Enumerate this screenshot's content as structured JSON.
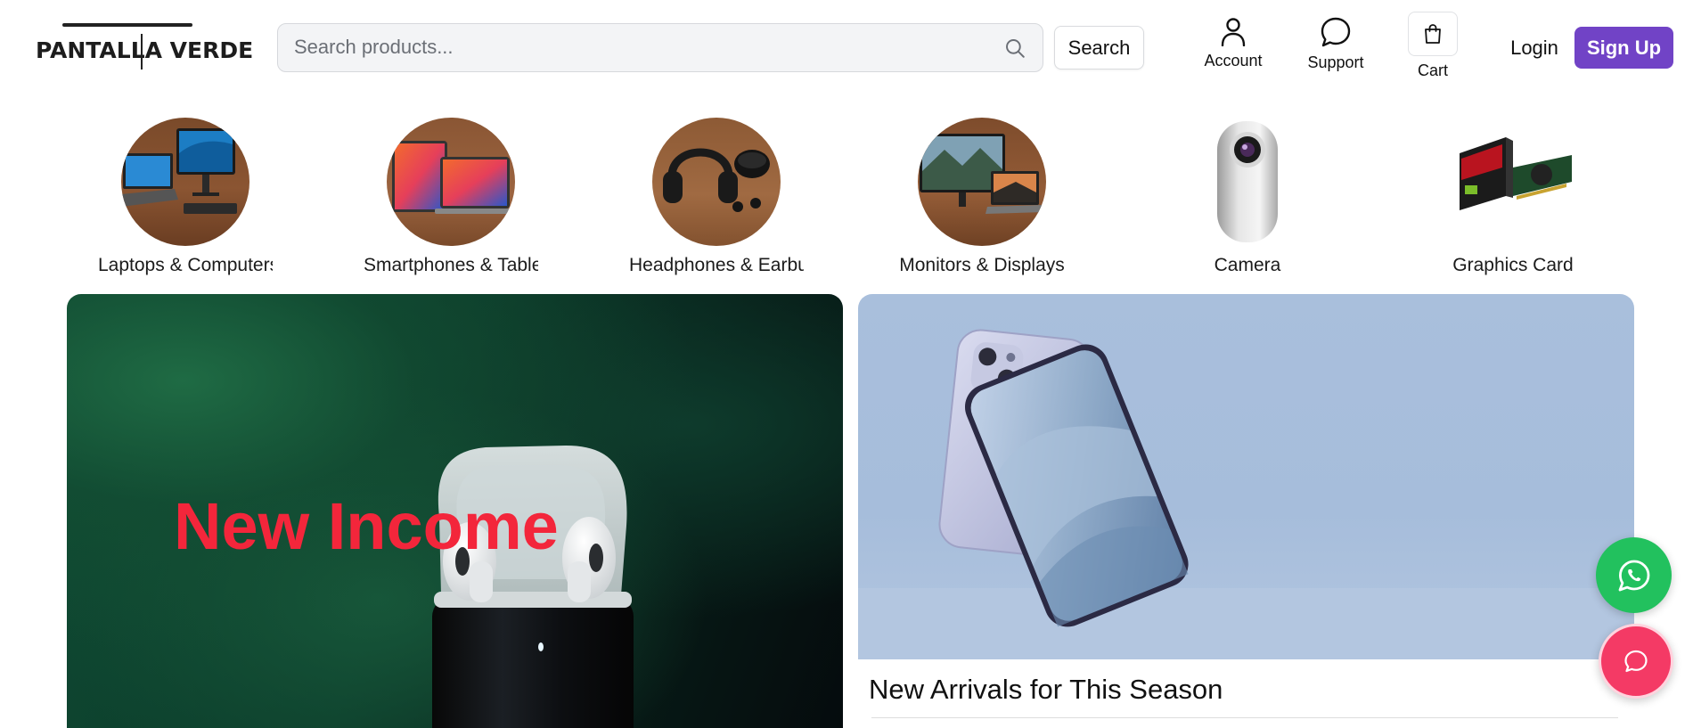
{
  "brand": {
    "logo_text": "PANTALLA VERDE"
  },
  "search": {
    "placeholder": "Search products...",
    "value": "",
    "button_label": "Search"
  },
  "nav": {
    "account_label": "Account",
    "support_label": "Support",
    "cart_label": "Cart",
    "login_label": "Login",
    "signup_label": "Sign Up"
  },
  "categories": [
    {
      "label": "Laptops & Computers",
      "image": "laptop-monitor-photo"
    },
    {
      "label": "Smartphones & Tablets",
      "image": "tablets-photo"
    },
    {
      "label": "Headphones & Earbuds",
      "image": "headphones-photo"
    },
    {
      "label": "Monitors & Displays",
      "image": "monitor-laptop-photo"
    },
    {
      "label": "Camera",
      "image": "camera-photo"
    },
    {
      "label": "Graphics Card",
      "image": "graphics-card-photo"
    }
  ],
  "banners": {
    "left": {
      "title": "New Income",
      "image": "airpods-photo"
    },
    "right": {
      "title": "New Arrivals for This Season",
      "image": "smartphone-photo"
    }
  },
  "floating": {
    "whatsapp_icon": "whatsapp-icon",
    "chat_icon": "chat-bubble-icon"
  },
  "colors": {
    "accent": "#7143c6",
    "banner_title": "#f3263b",
    "whatsapp": "#22c15e",
    "chat": "#f43a65"
  }
}
